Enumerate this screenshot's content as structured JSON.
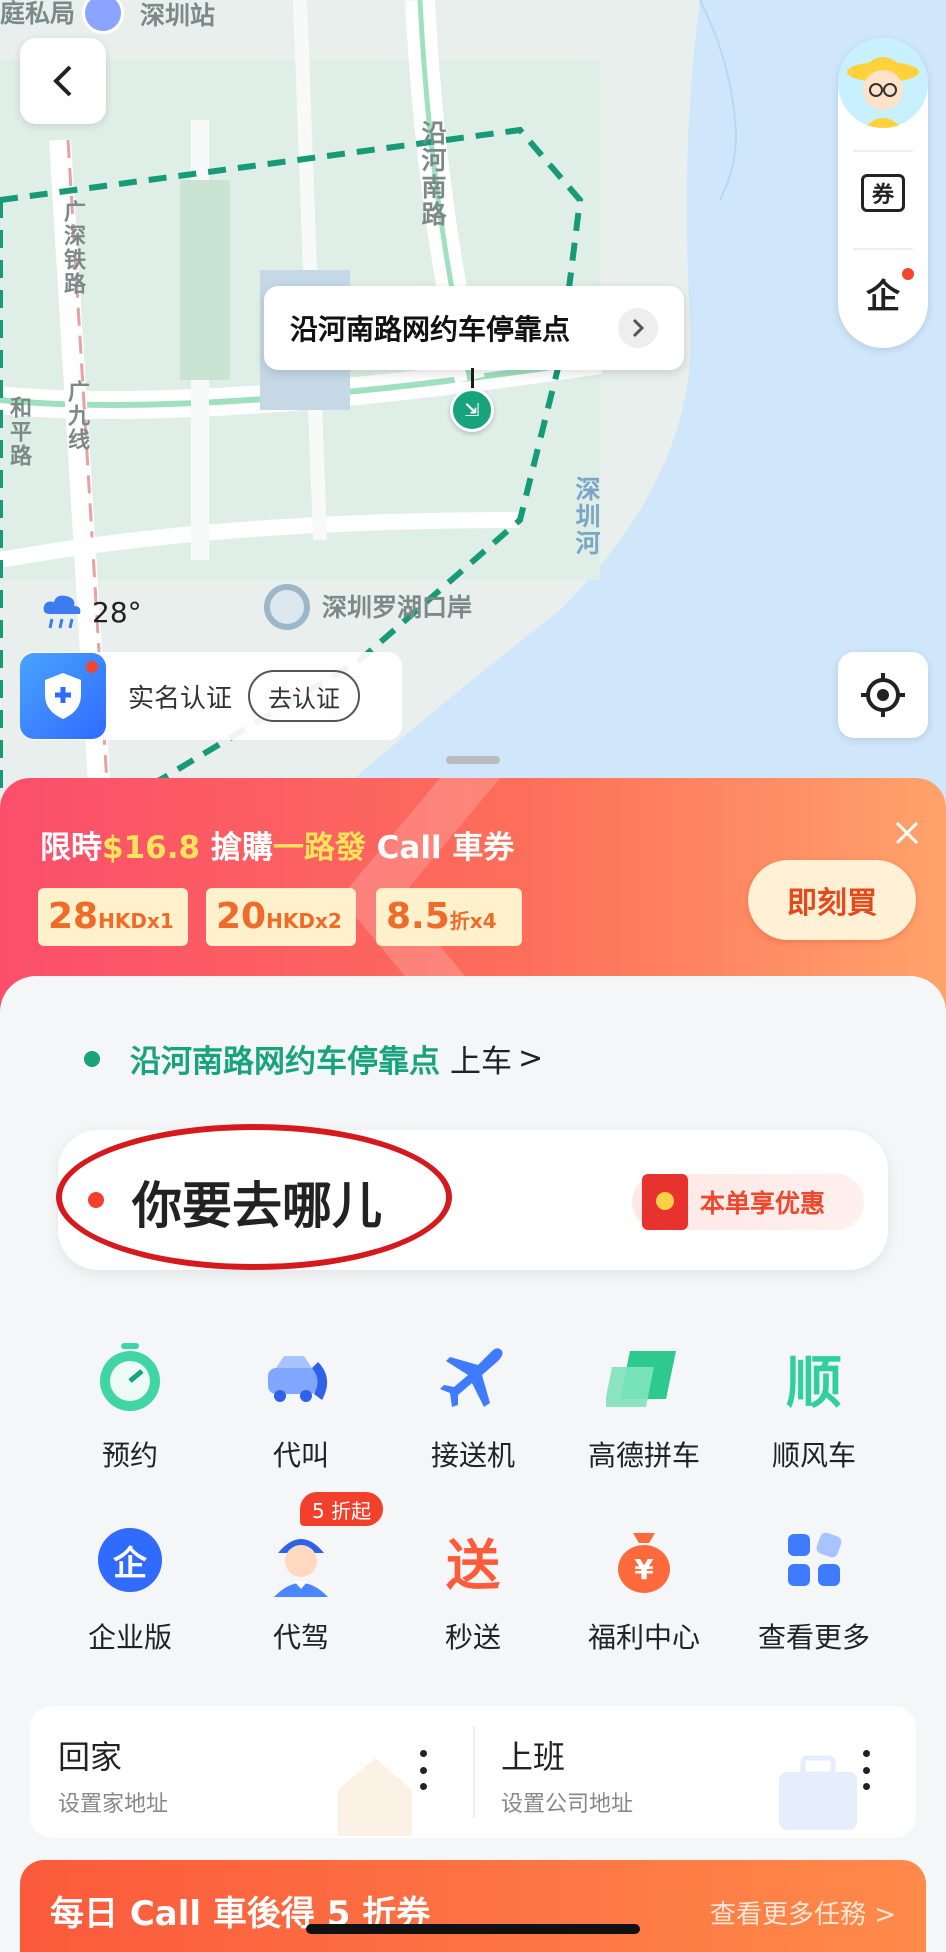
{
  "map": {
    "labels": {
      "top_left": "庭私局",
      "station": "深圳站",
      "road_v": "沿河南路",
      "rail_1": "广深铁路",
      "rail_2": "广九线",
      "road_left": "和平路",
      "river": "深圳河",
      "port": "深圳罗湖口岸"
    },
    "pickup_point": "沿河南路网约车停靠点",
    "weather_temp": "28°",
    "verify_text": "实名认证",
    "verify_btn": "去认证",
    "tools": {
      "coupon_icon": "券",
      "enterprise_icon": "企"
    }
  },
  "promo": {
    "title_pre": "限時",
    "title_price": "$16.8",
    "title_mid": " 搶購",
    "title_brand": "一路發",
    "title_post": " Call 車券",
    "coupons": [
      {
        "big": "28",
        "small": "HKDx1"
      },
      {
        "big": "20",
        "small": "HKDx2"
      },
      {
        "big": "8.5",
        "small": "折x4"
      }
    ],
    "buy_label": "即刻買"
  },
  "pickup": {
    "place": "沿河南路网约车停靠点",
    "action": "上车",
    "chevron": ">"
  },
  "destination": {
    "placeholder": "你要去哪儿",
    "discount": "本单享优惠"
  },
  "services": [
    {
      "label": "预约",
      "icon": "clock-icon"
    },
    {
      "label": "代叫",
      "icon": "car-phone-icon"
    },
    {
      "label": "接送机",
      "icon": "airplane-icon"
    },
    {
      "label": "高德拼车",
      "icon": "carpool-icon"
    },
    {
      "label": "顺风车",
      "icon": "shunfeng-icon",
      "glyph": "顺"
    },
    {
      "label": "企业版",
      "icon": "enterprise-icon",
      "glyph": "企"
    },
    {
      "label": "代驾",
      "icon": "driver-icon",
      "badge": "5 折起"
    },
    {
      "label": "秒送",
      "icon": "delivery-icon",
      "glyph": "送"
    },
    {
      "label": "福利中心",
      "icon": "money-bag-icon"
    },
    {
      "label": "查看更多",
      "icon": "more-grid-icon"
    }
  ],
  "home": {
    "title": "回家",
    "sub": "设置家地址"
  },
  "work": {
    "title": "上班",
    "sub": "设置公司地址"
  },
  "daily": {
    "title": "每日 Call 車後得 5 折券",
    "link": "查看更多任務 >"
  },
  "colors": {
    "brand_green": "#17a37b",
    "accent_red": "#f2402c",
    "promo_orange": "#fd6e5a"
  }
}
